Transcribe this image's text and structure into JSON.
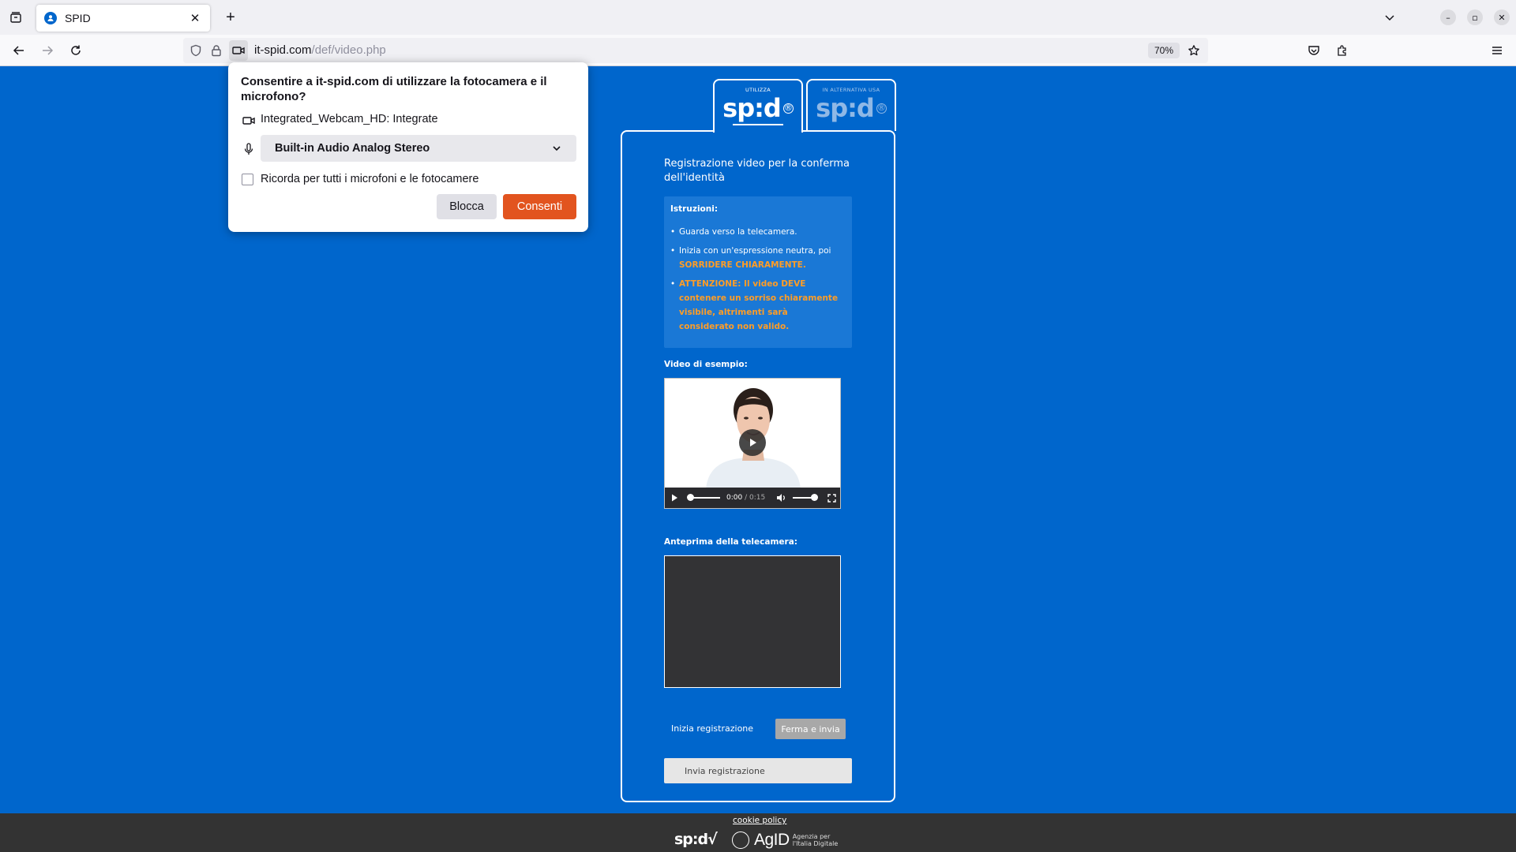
{
  "browser": {
    "tab_title": "SPID",
    "url_domain": "it-spid.com",
    "url_path": "/def/video.php",
    "zoom": "70%",
    "icons": {
      "tabs_list": "tabs-list-icon",
      "favicon": "user-shield-icon",
      "close": "close-icon",
      "new_tab": "plus-icon",
      "overflow": "chevron-down-icon",
      "back": "back-arrow-icon",
      "forward": "forward-arrow-icon",
      "reload": "reload-icon",
      "tracking": "shield-icon",
      "lock": "lock-icon",
      "camera_permission": "camera-icon",
      "bookmark": "star-icon",
      "pocket": "pocket-icon",
      "extensions": "puzzle-icon",
      "menu": "hamburger-menu-icon"
    }
  },
  "permission_popup": {
    "title": "Consentire a it-spid.com di utilizzare la fotocamera e il microfono?",
    "camera_device": "Integrated_Webcam_HD: Integrate",
    "microphone_device": "Built-in Audio Analog Stereo",
    "remember_label": "Ricorda per tutti i microfoni e le fotocamere",
    "block_label": "Blocca",
    "allow_label": "Consenti",
    "allow_color": "#e2541f"
  },
  "spid": {
    "tab_active_caption": "UTILIZZA",
    "tab_alt_caption": "IN ALTERNATIVA USA",
    "logo_text": "sp:d",
    "title": "Registrazione video per la conferma dell'identità",
    "instructions_heading": "Istruzioni:",
    "instruction_1": "Guarda verso la telecamera.",
    "instruction_2_plain": "Inizia con un'espressione neutra, poi ",
    "instruction_2_highlight": "SORRIDERE CHIARAMENTE.",
    "instruction_3": "ATTENZIONE: Il video DEVE contenere un sorriso chiaramente visibile, altrimenti sarà considerato non valido.",
    "example_video_label": "Video di esempio:",
    "video_time_current": "0:00",
    "video_time_duration": "/ 0:15",
    "camera_preview_label": "Anteprima della telecamera:",
    "start_recording": "Inizia registrazione",
    "stop_and_send": "Ferma e invia",
    "submit_recording": "Invia registrazione",
    "accent_color": "#0066cc",
    "highlight_color": "#ff9d26"
  },
  "footer": {
    "cookie_policy": "cookie policy",
    "spid_mark": "sp:d√",
    "agid_word": "AgID",
    "agid_subtitle": "Agenzia per l'Italia Digitale"
  }
}
